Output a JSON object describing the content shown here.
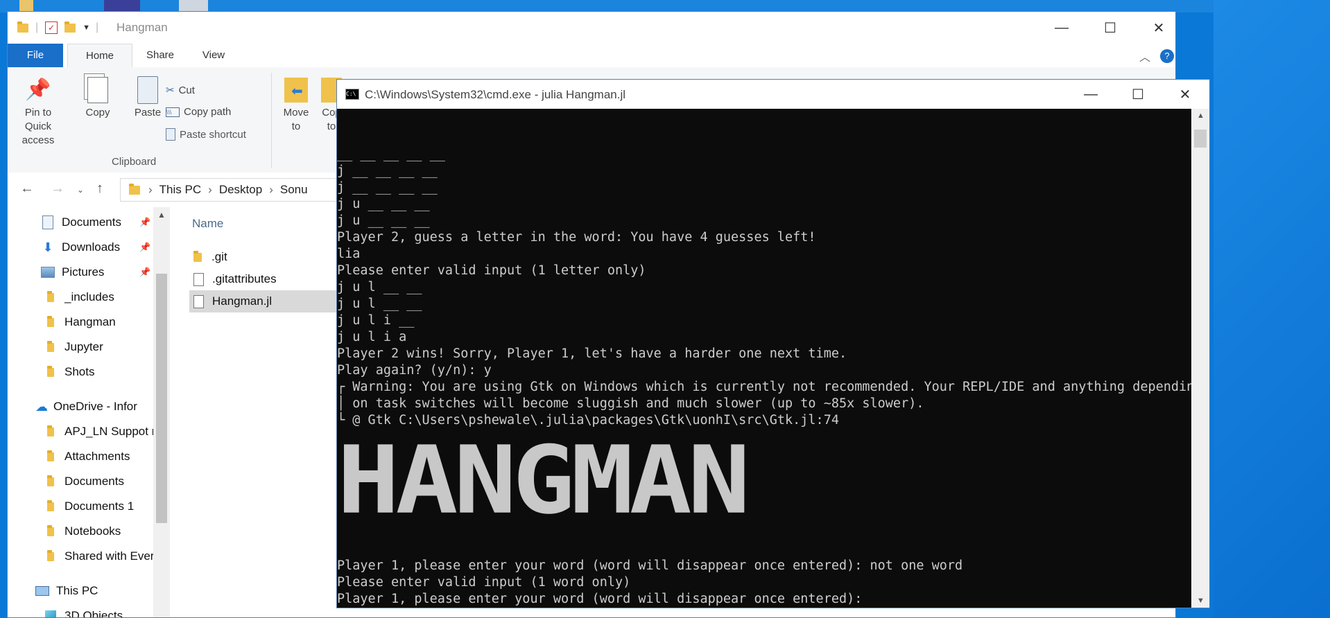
{
  "explorer": {
    "title": "Hangman",
    "tabs": [
      "File",
      "Home",
      "Share",
      "View"
    ],
    "ribbon": {
      "pin_label": "Pin to Quick access",
      "copy_label": "Copy",
      "paste_label": "Paste",
      "cut_label": "Cut",
      "copy_path_label": "Copy path",
      "paste_shortcut_label": "Paste shortcut",
      "clipboard_group": "Clipboard",
      "move_to_label": "Move to",
      "copy_to_label": "Cop to"
    },
    "breadcrumb": [
      "This PC",
      "Desktop",
      "Sonu"
    ],
    "nav_items": [
      {
        "label": "Documents",
        "icon": "documents-icon",
        "pinned": true
      },
      {
        "label": "Downloads",
        "icon": "downloads-icon",
        "pinned": true
      },
      {
        "label": "Pictures",
        "icon": "pictures-icon",
        "pinned": true
      },
      {
        "label": "_includes",
        "icon": "folder-icon"
      },
      {
        "label": "Hangman",
        "icon": "folder-icon"
      },
      {
        "label": "Jupyter",
        "icon": "folder-icon"
      },
      {
        "label": "Shots",
        "icon": "folder-icon"
      },
      {
        "label": "OneDrive - Infor",
        "icon": "onedrive-icon"
      },
      {
        "label": "APJ_LN Suppot r",
        "icon": "folder-icon"
      },
      {
        "label": "Attachments",
        "icon": "folder-icon"
      },
      {
        "label": "Documents",
        "icon": "folder-icon"
      },
      {
        "label": "Documents 1",
        "icon": "folder-icon"
      },
      {
        "label": "Notebooks",
        "icon": "folder-icon"
      },
      {
        "label": "Shared with Ever",
        "icon": "folder-icon"
      },
      {
        "label": "This PC",
        "icon": "computer-icon"
      },
      {
        "label": "3D Objects",
        "icon": "cube-icon"
      }
    ],
    "column_name": "Name",
    "files": [
      {
        "name": ".git",
        "type": "folder"
      },
      {
        "name": ".gitattributes",
        "type": "file"
      },
      {
        "name": "Hangman.jl",
        "type": "file",
        "selected": true
      }
    ]
  },
  "cmd": {
    "title": "C:\\Windows\\System32\\cmd.exe - julia  Hangman.jl",
    "lines": [
      "__ __ __ __ __",
      "j __ __ __ __",
      "j __ __ __ __",
      "j u __ __ __",
      "j u __ __ __",
      "Player 2, guess a letter in the word: You have 4 guesses left!",
      "lia",
      "Please enter valid input (1 letter only)",
      "j u l __ __",
      "j u l __ __",
      "j u l i __",
      "j u l i a",
      "Player 2 wins! Sorry, Player 1, let's have a harder one next time.",
      "Play again? (y/n): y",
      "┌ Warning: You are using Gtk on Windows which is currently not recommended. Your REPL/IDE and anything depending",
      "│ on task switches will become sluggish and much slower (up to ~85x slower).",
      "└ @ Gtk C:\\Users\\pshewale\\.julia\\packages\\Gtk\\uonhI\\src\\Gtk.jl:74"
    ],
    "banner": "HANGMAN",
    "bottom_lines": [
      "Player 1, please enter your word (word will disappear once entered): not one word",
      "Please enter valid input (1 word only)",
      "Player 1, please enter your word (word will disappear once entered):"
    ]
  }
}
